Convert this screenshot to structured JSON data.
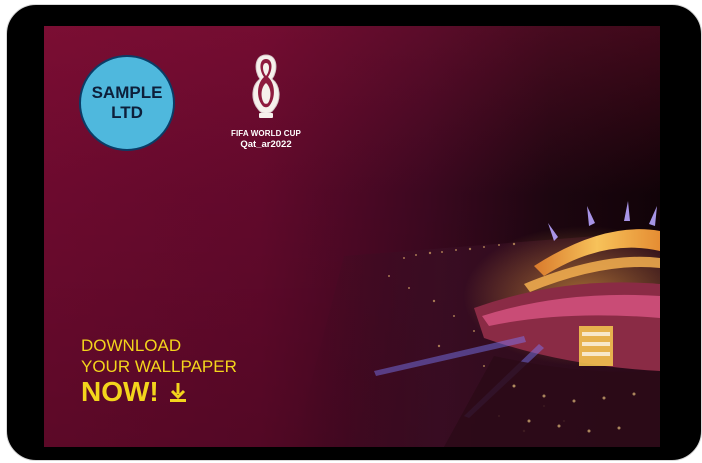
{
  "badge": {
    "line1": "SAMPLE",
    "line2": "LTD"
  },
  "event_logo": {
    "line1": "FIFA WORLD CUP",
    "line2": "Qat_ar2022"
  },
  "cta": {
    "line1": "DOWNLOAD",
    "line2": "YOUR WALLPAPER",
    "line3": "NOW!",
    "icon": "download-arrow-icon"
  },
  "colors": {
    "background_maroon": "#6c0a2e",
    "cta_yellow": "#f3d51c",
    "badge_blue": "#4fb8dd",
    "badge_border": "#0a3c66"
  }
}
